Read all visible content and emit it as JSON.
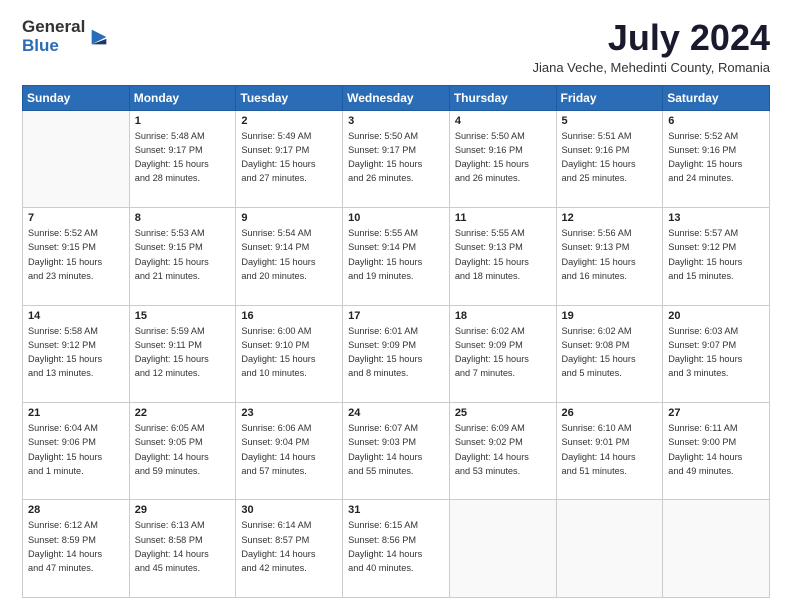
{
  "header": {
    "logo_general": "General",
    "logo_blue": "Blue",
    "month_title": "July 2024",
    "location": "Jiana Veche, Mehedinti County, Romania"
  },
  "calendar": {
    "days_of_week": [
      "Sunday",
      "Monday",
      "Tuesday",
      "Wednesday",
      "Thursday",
      "Friday",
      "Saturday"
    ],
    "weeks": [
      [
        {
          "day": "",
          "info": ""
        },
        {
          "day": "1",
          "info": "Sunrise: 5:48 AM\nSunset: 9:17 PM\nDaylight: 15 hours\nand 28 minutes."
        },
        {
          "day": "2",
          "info": "Sunrise: 5:49 AM\nSunset: 9:17 PM\nDaylight: 15 hours\nand 27 minutes."
        },
        {
          "day": "3",
          "info": "Sunrise: 5:50 AM\nSunset: 9:17 PM\nDaylight: 15 hours\nand 26 minutes."
        },
        {
          "day": "4",
          "info": "Sunrise: 5:50 AM\nSunset: 9:16 PM\nDaylight: 15 hours\nand 26 minutes."
        },
        {
          "day": "5",
          "info": "Sunrise: 5:51 AM\nSunset: 9:16 PM\nDaylight: 15 hours\nand 25 minutes."
        },
        {
          "day": "6",
          "info": "Sunrise: 5:52 AM\nSunset: 9:16 PM\nDaylight: 15 hours\nand 24 minutes."
        }
      ],
      [
        {
          "day": "7",
          "info": "Sunrise: 5:52 AM\nSunset: 9:15 PM\nDaylight: 15 hours\nand 23 minutes."
        },
        {
          "day": "8",
          "info": "Sunrise: 5:53 AM\nSunset: 9:15 PM\nDaylight: 15 hours\nand 21 minutes."
        },
        {
          "day": "9",
          "info": "Sunrise: 5:54 AM\nSunset: 9:14 PM\nDaylight: 15 hours\nand 20 minutes."
        },
        {
          "day": "10",
          "info": "Sunrise: 5:55 AM\nSunset: 9:14 PM\nDaylight: 15 hours\nand 19 minutes."
        },
        {
          "day": "11",
          "info": "Sunrise: 5:55 AM\nSunset: 9:13 PM\nDaylight: 15 hours\nand 18 minutes."
        },
        {
          "day": "12",
          "info": "Sunrise: 5:56 AM\nSunset: 9:13 PM\nDaylight: 15 hours\nand 16 minutes."
        },
        {
          "day": "13",
          "info": "Sunrise: 5:57 AM\nSunset: 9:12 PM\nDaylight: 15 hours\nand 15 minutes."
        }
      ],
      [
        {
          "day": "14",
          "info": "Sunrise: 5:58 AM\nSunset: 9:12 PM\nDaylight: 15 hours\nand 13 minutes."
        },
        {
          "day": "15",
          "info": "Sunrise: 5:59 AM\nSunset: 9:11 PM\nDaylight: 15 hours\nand 12 minutes."
        },
        {
          "day": "16",
          "info": "Sunrise: 6:00 AM\nSunset: 9:10 PM\nDaylight: 15 hours\nand 10 minutes."
        },
        {
          "day": "17",
          "info": "Sunrise: 6:01 AM\nSunset: 9:09 PM\nDaylight: 15 hours\nand 8 minutes."
        },
        {
          "day": "18",
          "info": "Sunrise: 6:02 AM\nSunset: 9:09 PM\nDaylight: 15 hours\nand 7 minutes."
        },
        {
          "day": "19",
          "info": "Sunrise: 6:02 AM\nSunset: 9:08 PM\nDaylight: 15 hours\nand 5 minutes."
        },
        {
          "day": "20",
          "info": "Sunrise: 6:03 AM\nSunset: 9:07 PM\nDaylight: 15 hours\nand 3 minutes."
        }
      ],
      [
        {
          "day": "21",
          "info": "Sunrise: 6:04 AM\nSunset: 9:06 PM\nDaylight: 15 hours\nand 1 minute."
        },
        {
          "day": "22",
          "info": "Sunrise: 6:05 AM\nSunset: 9:05 PM\nDaylight: 14 hours\nand 59 minutes."
        },
        {
          "day": "23",
          "info": "Sunrise: 6:06 AM\nSunset: 9:04 PM\nDaylight: 14 hours\nand 57 minutes."
        },
        {
          "day": "24",
          "info": "Sunrise: 6:07 AM\nSunset: 9:03 PM\nDaylight: 14 hours\nand 55 minutes."
        },
        {
          "day": "25",
          "info": "Sunrise: 6:09 AM\nSunset: 9:02 PM\nDaylight: 14 hours\nand 53 minutes."
        },
        {
          "day": "26",
          "info": "Sunrise: 6:10 AM\nSunset: 9:01 PM\nDaylight: 14 hours\nand 51 minutes."
        },
        {
          "day": "27",
          "info": "Sunrise: 6:11 AM\nSunset: 9:00 PM\nDaylight: 14 hours\nand 49 minutes."
        }
      ],
      [
        {
          "day": "28",
          "info": "Sunrise: 6:12 AM\nSunset: 8:59 PM\nDaylight: 14 hours\nand 47 minutes."
        },
        {
          "day": "29",
          "info": "Sunrise: 6:13 AM\nSunset: 8:58 PM\nDaylight: 14 hours\nand 45 minutes."
        },
        {
          "day": "30",
          "info": "Sunrise: 6:14 AM\nSunset: 8:57 PM\nDaylight: 14 hours\nand 42 minutes."
        },
        {
          "day": "31",
          "info": "Sunrise: 6:15 AM\nSunset: 8:56 PM\nDaylight: 14 hours\nand 40 minutes."
        },
        {
          "day": "",
          "info": ""
        },
        {
          "day": "",
          "info": ""
        },
        {
          "day": "",
          "info": ""
        }
      ]
    ]
  }
}
